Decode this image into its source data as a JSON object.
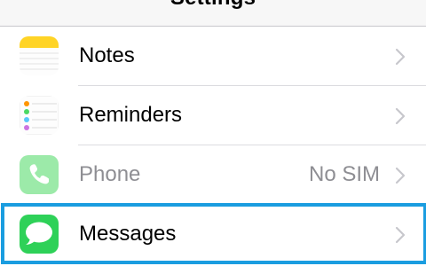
{
  "navbar": {
    "title": "Settings"
  },
  "rows": [
    {
      "label": "Notes",
      "value": "",
      "icon": "notes-icon",
      "enabled": true
    },
    {
      "label": "Reminders",
      "value": "",
      "icon": "reminders-icon",
      "enabled": true
    },
    {
      "label": "Phone",
      "value": "No SIM",
      "icon": "phone-icon",
      "enabled": false
    },
    {
      "label": "Messages",
      "value": "",
      "icon": "messages-icon",
      "enabled": true,
      "highlighted": true
    }
  ],
  "colors": {
    "highlight_border": "#1a9de0",
    "notes_yellow": "#ffd426",
    "phone_green": "#4cd964",
    "messages_green": "#2ed158",
    "secondary_text": "#8e8e93"
  }
}
